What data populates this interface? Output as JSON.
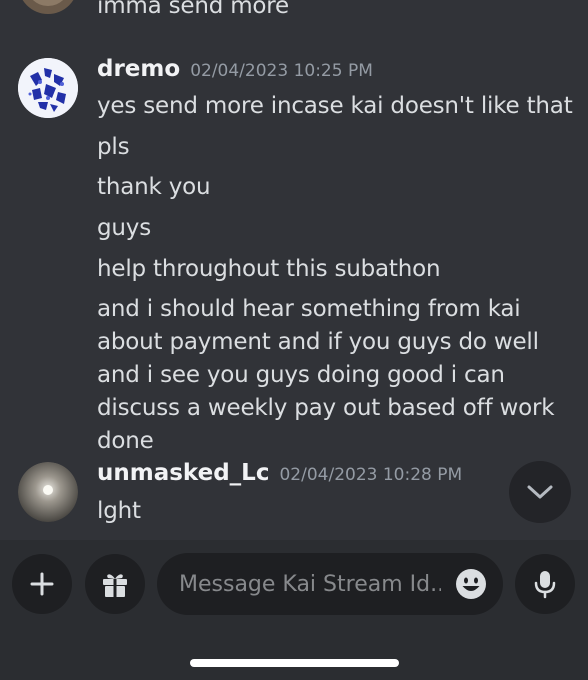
{
  "messages": {
    "prev_tail": "imma send more",
    "dremo": {
      "username": "dremo",
      "timestamp": "02/04/2023 10:25 PM",
      "lines": [
        "yes send more incase kai doesn't like that",
        "pls",
        "thank you",
        "guys",
        "help throughout this subathon",
        "and i should hear something from kai about payment and if you guys do well and i see you guys doing good i can discuss a weekly pay out based off work done"
      ]
    },
    "unmasked": {
      "username": "unmasked_Lc",
      "timestamp": "02/04/2023 10:28 PM",
      "lines": [
        "lght"
      ]
    }
  },
  "composer": {
    "placeholder": "Message Kai Stream Id..."
  },
  "icons": {
    "add": "plus-icon",
    "gift": "gift-icon",
    "emoji": "emoji-icon",
    "mic": "microphone-icon",
    "scroll": "chevron-down-icon"
  },
  "colors": {
    "background": "#313338",
    "bar": "#2b2d31",
    "input": "#1e1f22",
    "text": "#dbdee1",
    "muted": "#949ba4"
  }
}
